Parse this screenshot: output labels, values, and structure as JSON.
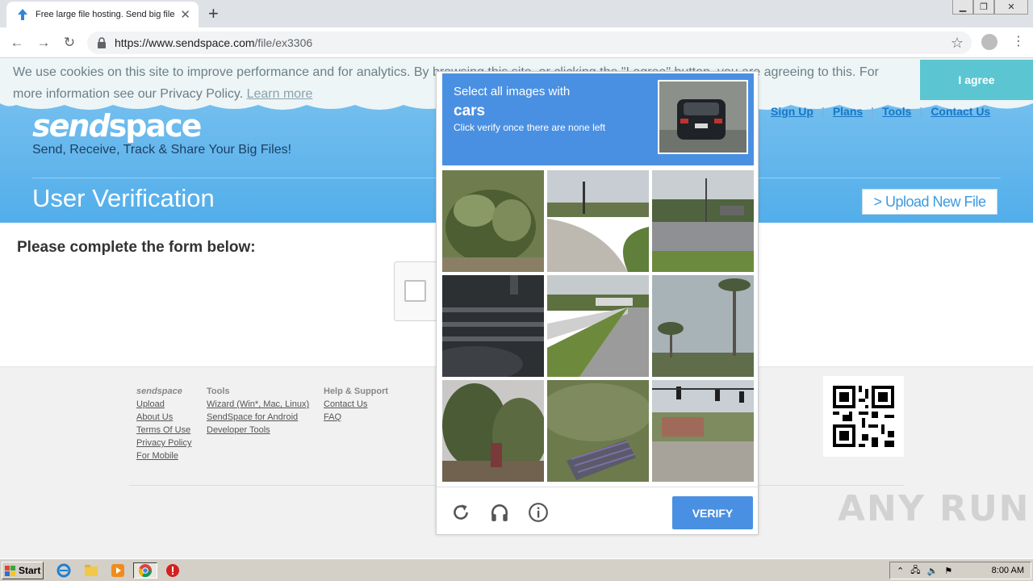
{
  "browser": {
    "tab_title": "Free large file hosting. Send big files",
    "url_host": "https://www.sendspace.com",
    "url_path": "/file/ex3306"
  },
  "cookie_banner": {
    "text": "We use cookies on this site to improve performance and for analytics. By browsing this site, or clicking the \"I agree\" button, you are agreeing to this. For more information see our Privacy Policy.",
    "learn_more": "Learn more",
    "agree": "I agree"
  },
  "header": {
    "logo_part1": "send",
    "logo_part2": "space",
    "tagline": "Send, Receive, Track & Share Your Big Files!",
    "nav": [
      "Sign Up",
      "Plans",
      "Tools",
      "Contact Us"
    ],
    "page_heading": "User Verification",
    "upload_button": "> Upload New File"
  },
  "main": {
    "form_title": "Please complete the form below:"
  },
  "captcha": {
    "instruction": "Select all images with",
    "target": "cars",
    "hint": "Click verify once there are none left",
    "verify": "VERIFY",
    "tiles": [
      "palm-bush",
      "curved-road",
      "street-intersection",
      "crosswalk-night",
      "highway-bridge",
      "palm-trees-sky",
      "trees-house",
      "grass-grate",
      "traffic-lights-street"
    ]
  },
  "footer": {
    "brand": "sendspace",
    "brand_links": [
      "Upload",
      "About Us",
      "Terms Of Use",
      "Privacy Policy",
      "For Mobile"
    ],
    "tools_heading": "Tools",
    "tools_links": [
      "Wizard (Win*, Mac, Linux)",
      "SendSpace for Android",
      "Developer Tools"
    ],
    "help_heading": "Help & Support",
    "help_links": [
      "Contact Us",
      "FAQ"
    ],
    "watermark": "ANY RUN"
  },
  "taskbar": {
    "start": "Start",
    "clock": "8:00 AM"
  }
}
